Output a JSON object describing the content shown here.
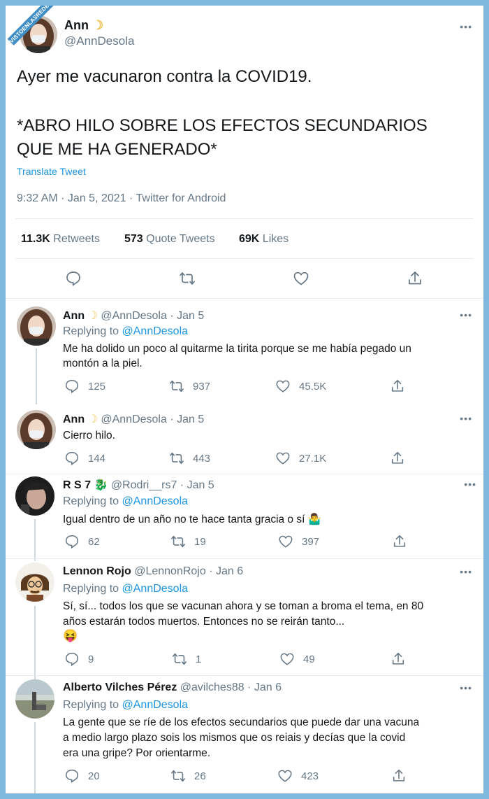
{
  "watermark": "VISTOENLASREDES.com",
  "main_tweet": {
    "display_name": "Ann",
    "handle": "@AnnDesola",
    "text_line1": "Ayer me vacunaron contra la COVID19.",
    "text_line2": "*ABRO HILO SOBRE LOS EFECTOS SECUNDARIOS",
    "text_line3": "QUE ME HA GENERADO*",
    "translate": "Translate Tweet",
    "meta": "9:32 AM · Jan 5, 2021 · Twitter for Android",
    "retweets_count": "11.3K",
    "retweets_label": "Retweets",
    "quotes_count": "573",
    "quotes_label": "Quote Tweets",
    "likes_count": "69K",
    "likes_label": "Likes"
  },
  "replying_prefix": "Replying to",
  "replying_handle": "@AnnDesola",
  "replies": [
    {
      "name": "Ann",
      "handle_date": "@AnnDesola · Jan 5",
      "lines": [
        "Me ha dolido un poco al quitarme la tirita porque se me había pegado un",
        "montón a la piel."
      ],
      "comments": "125",
      "retweets": "937",
      "likes": "45.5K"
    },
    {
      "name": "Ann",
      "handle_date": "@AnnDesola · Jan 5",
      "lines": [
        "Cierro hilo."
      ],
      "comments": "144",
      "retweets": "443",
      "likes": "27.1K"
    },
    {
      "name": "R S 7",
      "handle_date": "@Rodri__rs7 · Jan 5",
      "lines": [
        "Igual dentro de un año no te hace tanta gracia o sí"
      ],
      "comments": "62",
      "retweets": "19",
      "likes": "397"
    },
    {
      "name": "Lennon Rojo",
      "handle_date": "@LennonRojo · Jan 6",
      "lines": [
        "Sí, sí... todos los que se vacunan ahora y se toman a broma el tema, en 80",
        "años estarán todos muertos. Entonces no se reirán tanto..."
      ],
      "comments": "9",
      "retweets": "1",
      "likes": "49"
    },
    {
      "name": "Alberto Vilches Pérez",
      "handle_date": "@avilches88 · Jan 6",
      "lines": [
        "La gente que se ríe de los efectos secundarios que puede dar una vacuna",
        "a medio largo plazo sois los mismos que os reiais y decías que la covid",
        "era una gripe? Por orientarme."
      ],
      "comments": "20",
      "retweets": "26",
      "likes": "423"
    }
  ],
  "colors": {
    "accent": "#1b95e0",
    "muted": "#657786",
    "text": "#14171a",
    "frame": "#7fb8dc"
  }
}
